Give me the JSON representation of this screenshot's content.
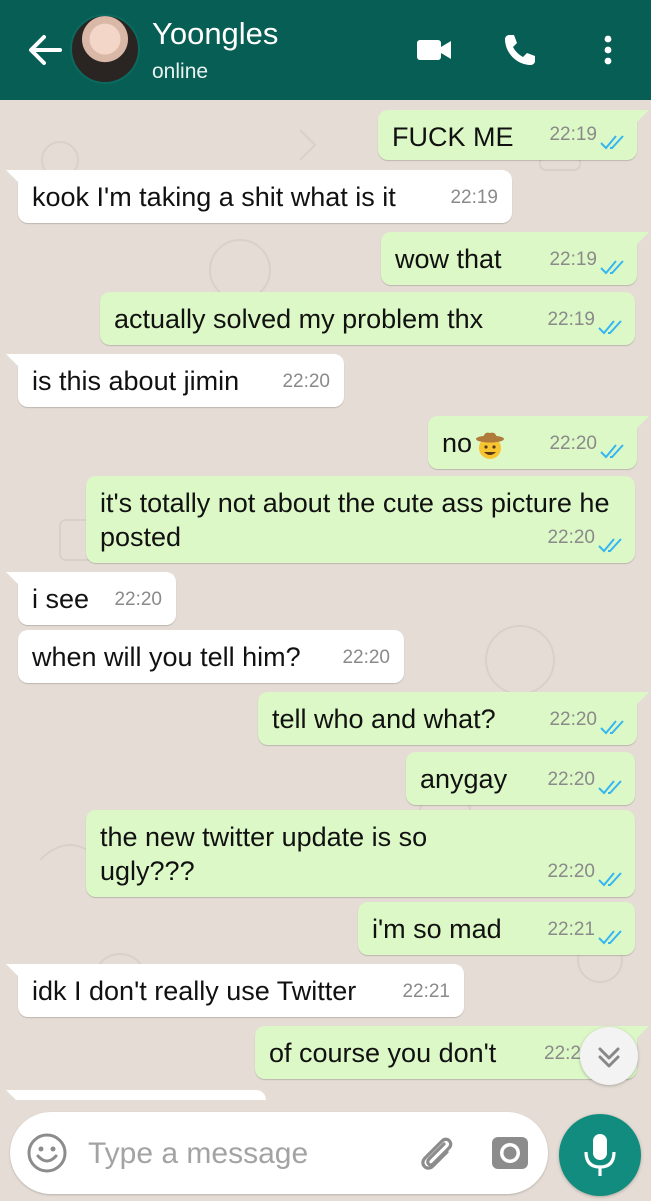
{
  "header": {
    "contact_name": "Yoongles",
    "status": "online",
    "icons": [
      "back-arrow-icon",
      "video-call-icon",
      "voice-call-icon",
      "more-options-icon"
    ]
  },
  "colors": {
    "header": "#075e54",
    "outgoing_bubble": "#dcf8c6",
    "incoming_bubble": "#ffffff",
    "chat_background": "#e5ddd5",
    "read_tick": "#34b7f1",
    "mic_button": "#128c7e"
  },
  "messages": [
    {
      "dir": "out",
      "text": "FUCK ME",
      "time": "22:19",
      "status": "read"
    },
    {
      "dir": "in",
      "text": "kook I'm taking a shit what is it",
      "time": "22:19"
    },
    {
      "dir": "out",
      "text": "wow that",
      "time": "22:19",
      "status": "read"
    },
    {
      "dir": "out",
      "text": "actually solved my problem thx",
      "time": "22:19",
      "status": "read"
    },
    {
      "dir": "in",
      "text": "is this about jimin",
      "time": "22:20"
    },
    {
      "dir": "out",
      "text": "no",
      "emoji": "cowboy-emoji",
      "time": "22:20",
      "status": "read"
    },
    {
      "dir": "out",
      "text": "it's totally not about the cute ass picture he posted",
      "time": "22:20",
      "status": "read"
    },
    {
      "dir": "in",
      "text": "i see",
      "time": "22:20"
    },
    {
      "dir": "in",
      "text": "when will you tell him?",
      "time": "22:20"
    },
    {
      "dir": "out",
      "text": "tell who and what?",
      "time": "22:20",
      "status": "read"
    },
    {
      "dir": "out",
      "text": "anygay",
      "time": "22:20",
      "status": "read"
    },
    {
      "dir": "out",
      "text": "the new twitter update is so ugly???",
      "time": "22:20",
      "status": "read"
    },
    {
      "dir": "out",
      "text": "i'm so mad",
      "time": "22:21",
      "status": "read"
    },
    {
      "dir": "in",
      "text": "idk I don't really use Twitter",
      "time": "22:21"
    },
    {
      "dir": "out",
      "text": "of course you don't",
      "time": "22:2",
      "status": "read"
    }
  ],
  "composer": {
    "placeholder": "Type a message",
    "icons": [
      "emoji-icon",
      "attach-icon",
      "camera-icon",
      "mic-icon"
    ]
  }
}
